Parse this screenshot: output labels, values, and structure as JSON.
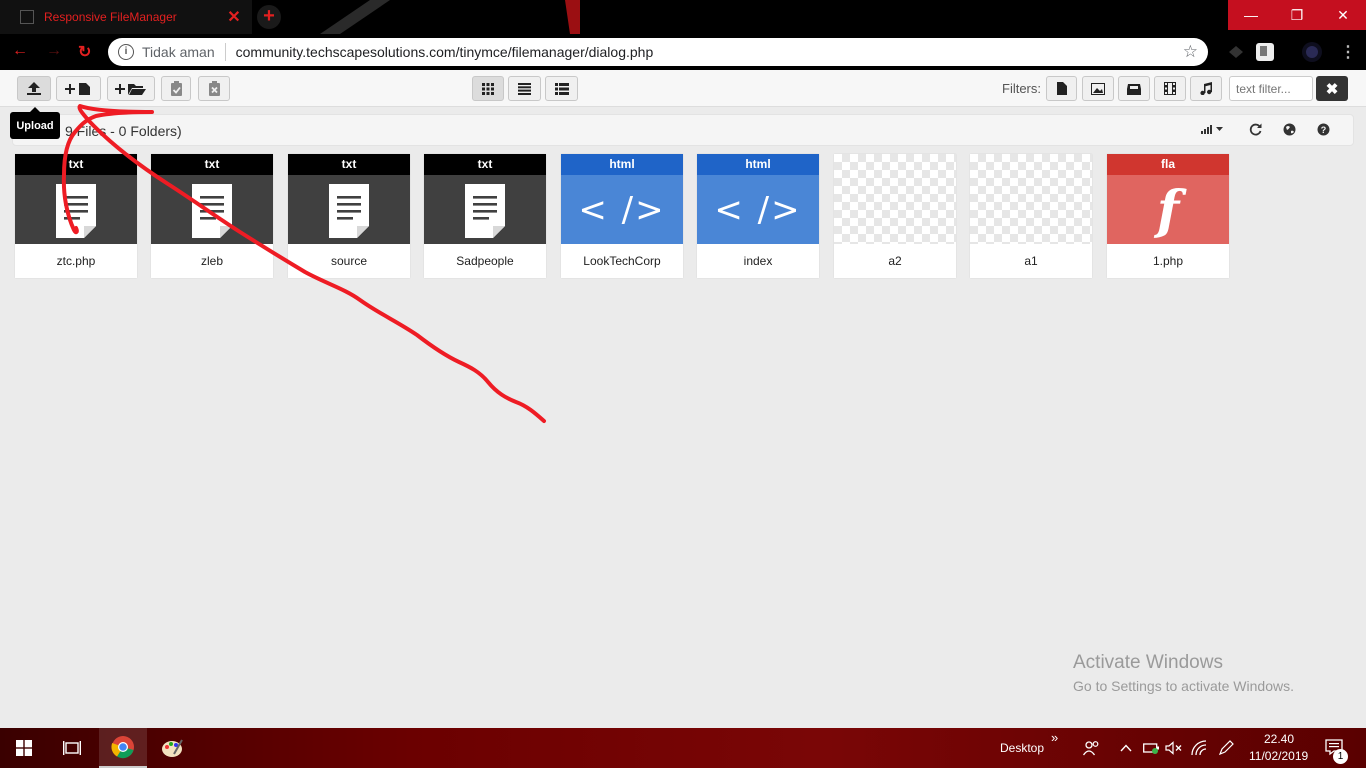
{
  "browser": {
    "tab_title": "Responsive FileManager",
    "tab_close": "✕",
    "new_tab": "+",
    "security_text": "Tidak aman",
    "url": "community.techscapesolutions.com/tinymce/filemanager/dialog.php",
    "window_buttons": [
      "—",
      "❐",
      "✕"
    ],
    "menu_glyph": "⋮"
  },
  "toolbar": {
    "filters_label": "Filters:",
    "text_filter_placeholder": "text filter...",
    "clear_glyph": "✖"
  },
  "breadcrumb": {
    "summary": "9 Files - 0 Folders)"
  },
  "tooltip": {
    "text": "Upload"
  },
  "files": [
    {
      "ext": "txt",
      "name": "ztc.php",
      "kind": "doc",
      "color": "#000000"
    },
    {
      "ext": "txt",
      "name": "zleb",
      "kind": "doc",
      "color": "#000000"
    },
    {
      "ext": "txt",
      "name": "source",
      "kind": "doc",
      "color": "#000000"
    },
    {
      "ext": "txt",
      "name": "Sadpeople",
      "kind": "doc",
      "color": "#000000"
    },
    {
      "ext": "html",
      "name": "LookTechCorp",
      "kind": "code",
      "color": "#1f64c8"
    },
    {
      "ext": "html",
      "name": "index",
      "kind": "code",
      "color": "#1f64c8"
    },
    {
      "ext": "",
      "name": "a2",
      "kind": "image"
    },
    {
      "ext": "",
      "name": "a1",
      "kind": "image"
    },
    {
      "ext": "fla",
      "name": "1.php",
      "kind": "flash",
      "color": "#d0362f"
    }
  ],
  "watermark": {
    "title": "Activate Windows",
    "subtitle": "Go to Settings to activate Windows."
  },
  "taskbar": {
    "desktop_label": "Desktop",
    "chevrons": "»",
    "time": "22.40",
    "date": "11/02/2019",
    "notification_count": "1"
  },
  "colors": {
    "accent": "#e32020",
    "doc_thumb": "#404040",
    "code_thumb": "#4a86d6",
    "flash_thumb": "#e06560",
    "annotation": "#ee1c24"
  }
}
